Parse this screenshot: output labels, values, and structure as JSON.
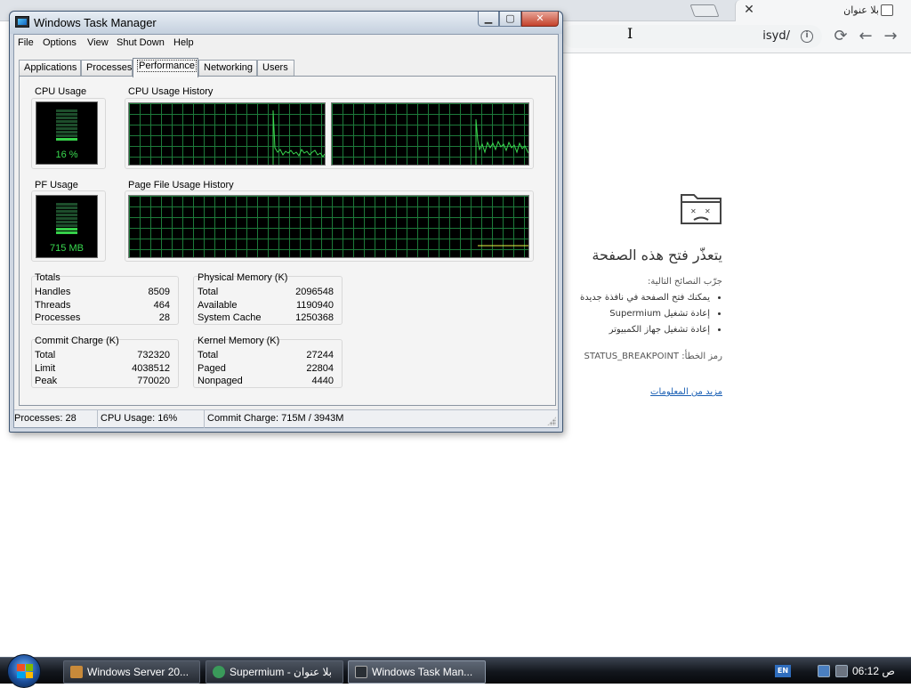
{
  "browser": {
    "tab_title": "بلا عنوان",
    "url": "isyd/",
    "error": {
      "title": "يتعذّر فتح هذه الصفحة",
      "try_label": "جرّب النصائح التالية:",
      "suggestions": [
        "يمكنك فتح الصفحة في نافذة جديدة",
        "إعادة تشغيل Supermium",
        "إعادة تشغيل جهاز الكمبيوتر"
      ],
      "error_code": "رمز الخطأ: STATUS_BREAKPOINT",
      "more_link": "مزيد من المعلومات"
    }
  },
  "task_manager": {
    "title": "Windows Task Manager",
    "menu": [
      "File",
      "Options",
      "View",
      "Shut Down",
      "Help"
    ],
    "tabs": [
      "Applications",
      "Processes",
      "Performance",
      "Networking",
      "Users"
    ],
    "active_tab": "Performance",
    "cpu_usage_label": "CPU Usage",
    "cpu_usage_value": "16 %",
    "cpu_usage_fraction": 0.16,
    "cpu_history_label": "CPU Usage History",
    "pf_usage_label": "PF Usage",
    "pf_usage_value": "715 MB",
    "pf_usage_fraction": 0.18,
    "pf_history_label": "Page File Usage History",
    "totals": {
      "title": "Totals",
      "rows": [
        {
          "label": "Handles",
          "value": "8509"
        },
        {
          "label": "Threads",
          "value": "464"
        },
        {
          "label": "Processes",
          "value": "28"
        }
      ]
    },
    "physical_memory": {
      "title": "Physical Memory (K)",
      "rows": [
        {
          "label": "Total",
          "value": "2096548"
        },
        {
          "label": "Available",
          "value": "1190940"
        },
        {
          "label": "System Cache",
          "value": "1250368"
        }
      ]
    },
    "commit_charge": {
      "title": "Commit Charge (K)",
      "rows": [
        {
          "label": "Total",
          "value": "732320"
        },
        {
          "label": "Limit",
          "value": "4038512"
        },
        {
          "label": "Peak",
          "value": "770020"
        }
      ]
    },
    "kernel_memory": {
      "title": "Kernel Memory (K)",
      "rows": [
        {
          "label": "Total",
          "value": "27244"
        },
        {
          "label": "Paged",
          "value": "22804"
        },
        {
          "label": "Nonpaged",
          "value": "4440"
        }
      ]
    },
    "status": {
      "processes": "Processes: 28",
      "cpu": "CPU Usage: 16%",
      "commit": "Commit Charge: 715M / 3943M"
    }
  },
  "taskbar": {
    "buttons": [
      {
        "label": "Windows Server 20...",
        "icon": "server-icon"
      },
      {
        "label": "Supermium - بلا عنوان",
        "icon": "supermium-icon"
      },
      {
        "label": "Windows Task Man...",
        "icon": "task-manager-icon"
      }
    ],
    "language": "EN",
    "clock": "06:12 ص"
  },
  "colors": {
    "graph_line": "#39d94f",
    "graph_grid": "#1d7a3a",
    "pf_line": "#e9f542"
  }
}
